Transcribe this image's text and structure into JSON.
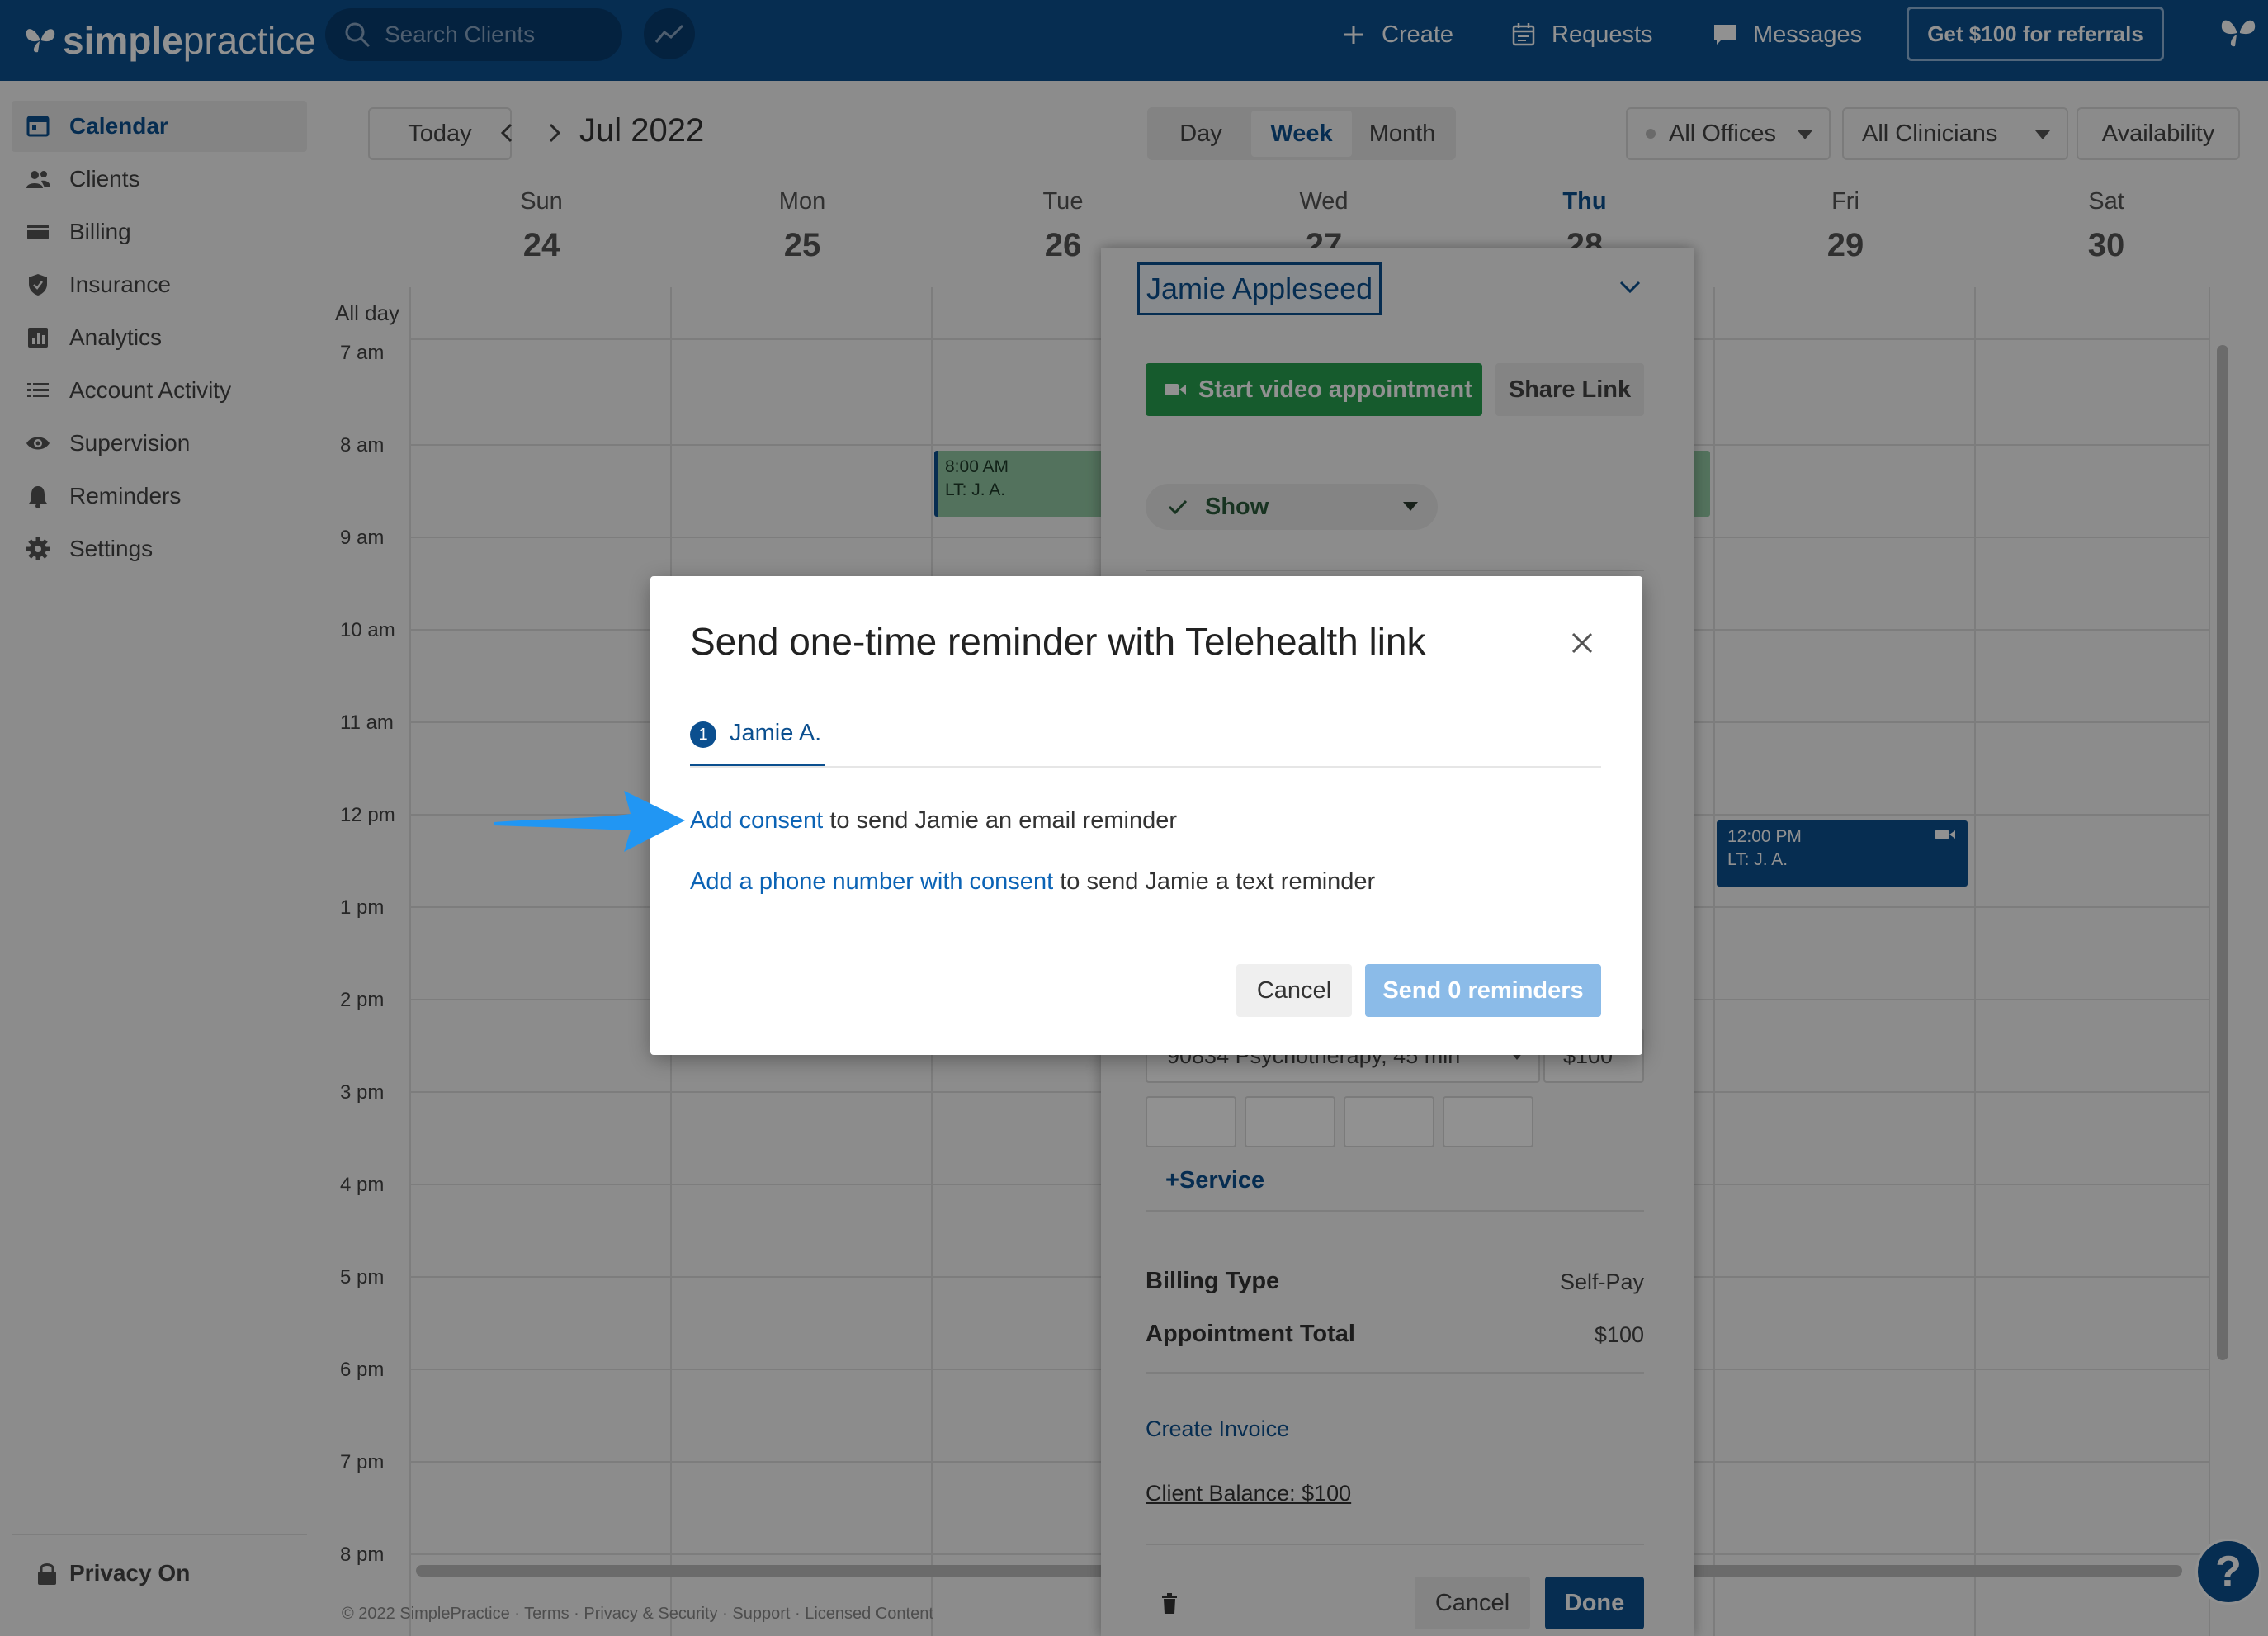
{
  "header": {
    "brand_simple": "simple",
    "brand_practice": "practice",
    "search_placeholder": "Search Clients",
    "create": "Create",
    "requests": "Requests",
    "messages": "Messages",
    "referral": "Get $100 for referrals"
  },
  "sidebar": {
    "items": [
      {
        "label": "Calendar",
        "icon": "calendar-icon"
      },
      {
        "label": "Clients",
        "icon": "clients-icon"
      },
      {
        "label": "Billing",
        "icon": "billing-icon"
      },
      {
        "label": "Insurance",
        "icon": "shield-icon"
      },
      {
        "label": "Analytics",
        "icon": "analytics-icon"
      },
      {
        "label": "Account Activity",
        "icon": "list-icon"
      },
      {
        "label": "Supervision",
        "icon": "eye-icon"
      },
      {
        "label": "Reminders",
        "icon": "bell-icon"
      },
      {
        "label": "Settings",
        "icon": "gear-icon"
      }
    ],
    "privacy": "Privacy On"
  },
  "calendar": {
    "today": "Today",
    "month": "Jul 2022",
    "views": [
      "Day",
      "Week",
      "Month"
    ],
    "active_view": "Week",
    "offices": "All Offices",
    "clinicians": "All Clinicians",
    "availability": "Availability",
    "days": [
      {
        "name": "Sun",
        "date": "24"
      },
      {
        "name": "Mon",
        "date": "25"
      },
      {
        "name": "Tue",
        "date": "26"
      },
      {
        "name": "Wed",
        "date": "27"
      },
      {
        "name": "Thu",
        "date": "28"
      },
      {
        "name": "Fri",
        "date": "29"
      },
      {
        "name": "Sat",
        "date": "30"
      }
    ],
    "allday": "All day",
    "hours": [
      "7 am",
      "8 am",
      "9 am",
      "10 am",
      "11 am",
      "12 pm",
      "1 pm",
      "2 pm",
      "3 pm",
      "4 pm",
      "5 pm",
      "6 pm",
      "7 pm",
      "8 pm"
    ],
    "events": [
      {
        "time": "8:00 AM",
        "label": "LT: J. A."
      },
      {
        "time": "12:00 PM",
        "label": "LT: J. A."
      }
    ],
    "footer": "© 2022 SimplePractice · Terms · Privacy & Security · Support · Licensed Content"
  },
  "panel": {
    "client": "Jamie Appleseed",
    "start_video": "Start video appointment",
    "share_link": "Share Link",
    "status": "Show",
    "service": "90834 Psychotherapy, 45 min",
    "fee": "$100",
    "add_service": "+Service",
    "billing_type_label": "Billing Type",
    "billing_type_value": "Self-Pay",
    "total_label": "Appointment Total",
    "total_value": "$100",
    "create_invoice": "Create Invoice",
    "balance": "Client Balance: $100",
    "cancel": "Cancel",
    "done": "Done"
  },
  "modal": {
    "title": "Send one-time reminder with Telehealth link",
    "tab_number": "1",
    "tab_label": "Jamie A.",
    "email_link": "Add consent",
    "email_text": " to send Jamie an email reminder",
    "sms_link": "Add a phone number with consent",
    "sms_text": " to send Jamie a text reminder",
    "cancel": "Cancel",
    "send": "Send 0 reminders"
  },
  "help": "?",
  "colors": {
    "brand": "#0b4f8f",
    "green": "#27a150",
    "link": "#0b63b5",
    "callout": "#2196f3"
  }
}
